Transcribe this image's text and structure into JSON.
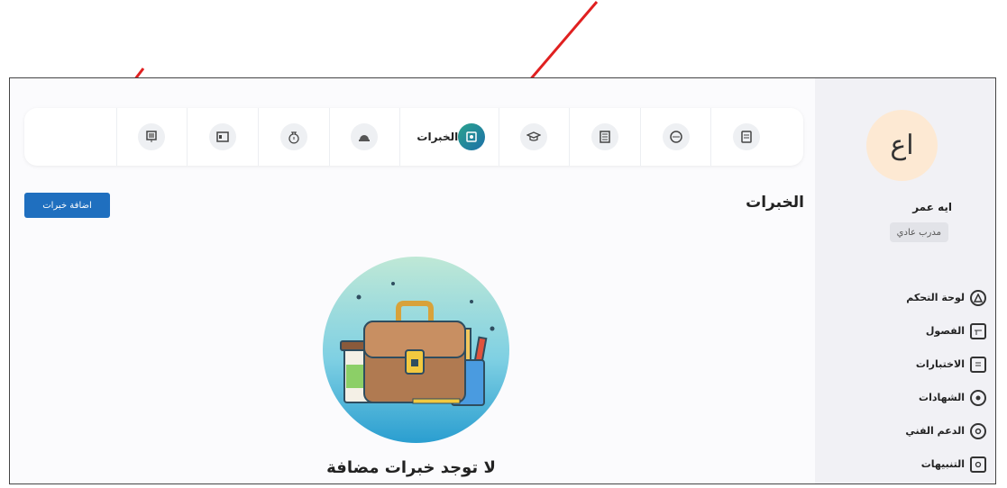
{
  "tabs": [
    {
      "icon": "certificate-icon",
      "label": ""
    },
    {
      "icon": "smile-icon",
      "label": ""
    },
    {
      "icon": "document-icon",
      "label": ""
    },
    {
      "icon": "graduation-cap-icon",
      "label": ""
    },
    {
      "icon": "experience-icon",
      "label": "الخبرات",
      "active": true
    },
    {
      "icon": "helmet-icon",
      "label": ""
    },
    {
      "icon": "money-bag-icon",
      "label": ""
    },
    {
      "icon": "id-card-icon",
      "label": ""
    },
    {
      "icon": "presentation-icon",
      "label": ""
    },
    {
      "icon": "",
      "label": ""
    }
  ],
  "main": {
    "title": "الخبرات",
    "add_button_label": "اضافة خبرات",
    "empty_message": "لا توجد خبرات مضافة"
  },
  "user": {
    "avatar_text": "اع",
    "name": "ايه عمر",
    "role": "مدرب عادي"
  },
  "menu": [
    {
      "label": "لوحة التحكم",
      "icon": "dashboard-icon"
    },
    {
      "label": "الفصول",
      "icon": "classes-icon"
    },
    {
      "label": "الاختبارات",
      "icon": "exams-icon"
    },
    {
      "label": "الشهادات",
      "icon": "certificates-icon"
    },
    {
      "label": "الدعم الفني",
      "icon": "support-icon"
    },
    {
      "label": "التنبيهات",
      "icon": "notifications-icon"
    }
  ],
  "colors": {
    "accent": "#1f6fbf",
    "annotation_arrow": "#e02020",
    "active_tab_start": "#2aa38d",
    "active_tab_end": "#1d6fa8",
    "avatar_bg": "#fde9d3"
  }
}
